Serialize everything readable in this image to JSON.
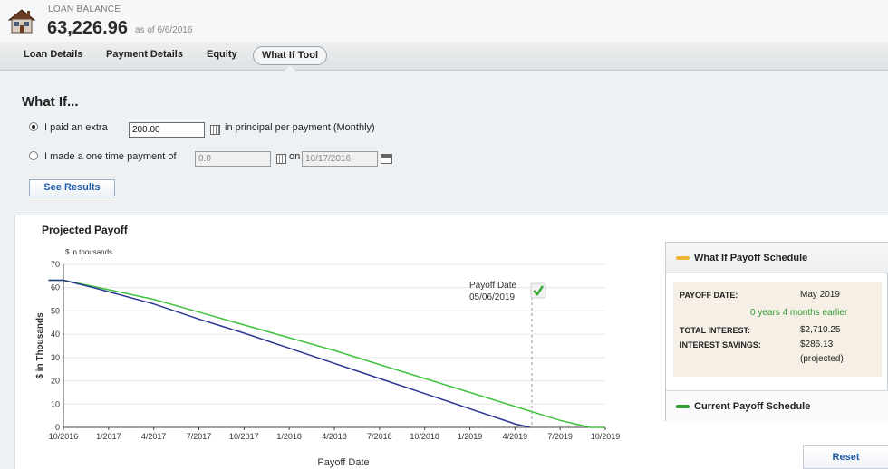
{
  "header": {
    "label": "LOAN BALANCE",
    "amount": "63,226.96",
    "as_of": "as of 6/6/2016",
    "icon": "house-icon"
  },
  "tabs": [
    {
      "label": "Loan Details",
      "active": false
    },
    {
      "label": "Payment Details",
      "active": false
    },
    {
      "label": "Equity",
      "active": false
    },
    {
      "label": "What If Tool",
      "active": true
    }
  ],
  "whatif": {
    "title": "What If...",
    "option1": {
      "prefix": "I paid an extra",
      "value": "200.00",
      "suffix": "in principal per payment (Monthly)",
      "selected": true
    },
    "option2": {
      "prefix": "I made a one time payment of",
      "value": "0.0",
      "on_label": "on",
      "date": "10/17/2016",
      "selected": false
    },
    "see_results": "See Results"
  },
  "chart_title": "Projected Payoff",
  "chart_data": {
    "type": "line",
    "ylabel_top": "$ in thousands",
    "ylabel": "$ in Thousands",
    "xlabel": "Payoff Date",
    "ylim": [
      0,
      70
    ],
    "yticks": [
      "0",
      "10",
      "20",
      "30",
      "40",
      "50",
      "60",
      "70"
    ],
    "xticks": [
      "10/2016",
      "1/2017",
      "4/2017",
      "7/2017",
      "10/2017",
      "1/2018",
      "4/2018",
      "7/2018",
      "10/2018",
      "1/2019",
      "4/2019",
      "7/2019",
      "10/2019"
    ],
    "x_months_from_oct_2016": [
      0,
      3,
      6,
      9,
      12,
      15,
      18,
      21,
      24,
      27,
      30,
      33,
      36
    ],
    "series": [
      {
        "color": "#2a3590",
        "x": [
          "2016-09",
          "2016-10",
          "2016-12",
          "2017-04",
          "2017-07",
          "2017-10",
          "2018-01",
          "2018-04",
          "2018-07",
          "2018-10",
          "2019-01",
          "2019-04",
          "2019-05"
        ],
        "y": [
          63.2,
          63.2,
          60,
          53,
          46.5,
          40.5,
          34,
          27.5,
          21,
          14.5,
          8,
          1.5,
          0
        ]
      },
      {
        "color": "#3fc23f",
        "x": [
          "2016-09",
          "2016-10",
          "2016-12",
          "2017-04",
          "2017-07",
          "2017-10",
          "2018-01",
          "2018-04",
          "2018-07",
          "2018-10",
          "2019-01",
          "2019-04",
          "2019-07",
          "2019-09",
          "2019-10"
        ],
        "y": [
          63.2,
          63.2,
          60.5,
          55,
          49.5,
          44,
          38.5,
          33,
          27,
          21,
          15,
          9,
          3,
          0,
          0
        ]
      }
    ],
    "annotation": {
      "label": "Payoff Date",
      "date": "05/06/2019",
      "x": "2019-05"
    }
  },
  "schedule": {
    "whatif_title": "What If Payoff Schedule",
    "whatif_color": "#f1b431",
    "payoff_date_label": "PAYOFF DATE:",
    "payoff_date": "May 2019",
    "earlier": "0 years 4 months earlier",
    "total_interest_label": "TOTAL INTEREST:",
    "total_interest": "$2,710.25",
    "savings_label": "INTEREST SAVINGS:",
    "savings": "$286.13",
    "projected": "(projected)",
    "current_title": "Current Payoff Schedule",
    "current_color": "#2e9a33"
  },
  "reset": "Reset"
}
